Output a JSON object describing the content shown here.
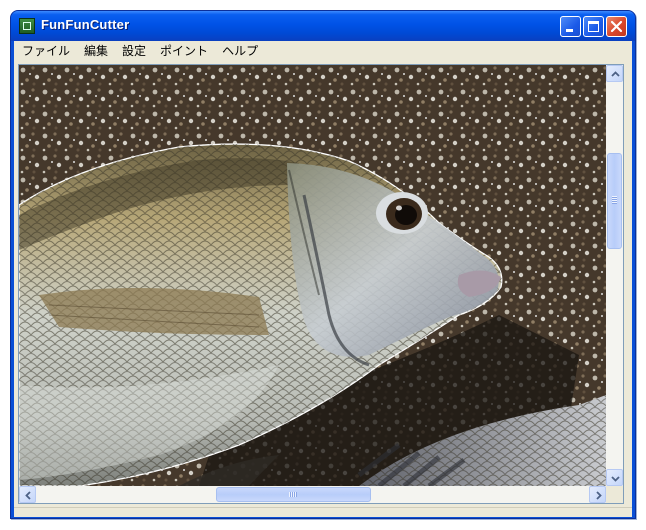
{
  "window": {
    "title": "FunFunCutter",
    "icon": "app-icon",
    "controls": [
      "minimize-icon",
      "maximize-icon",
      "close-icon"
    ]
  },
  "menu": {
    "items": [
      "ファイル",
      "編集",
      "設定",
      "ポイント",
      "ヘルプ"
    ]
  },
  "scrollbars": {
    "vertical_position": 0.21,
    "horizontal_position": 0.37
  },
  "colors": {
    "titlebar": "#0052e6",
    "close_button": "#d9472b",
    "cut_outline": "#ffffff"
  }
}
